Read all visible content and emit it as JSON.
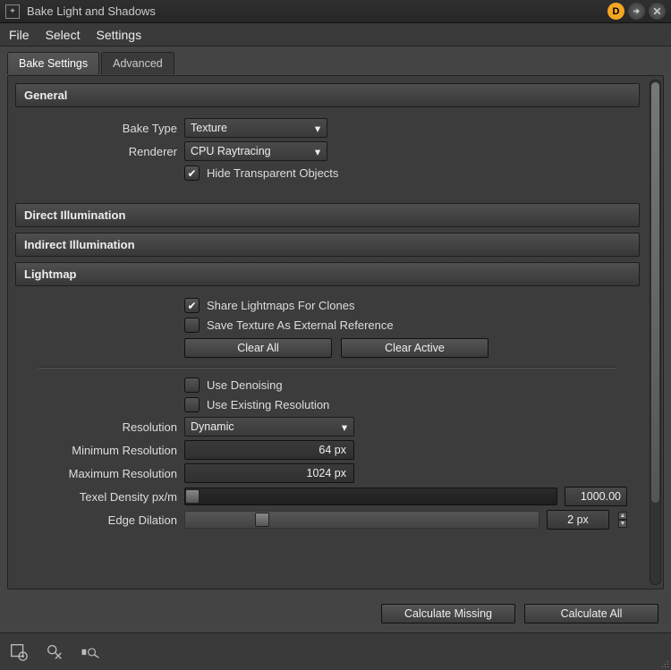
{
  "window": {
    "title": "Bake Light and Shadows",
    "badge": "D"
  },
  "menubar": {
    "file": "File",
    "select": "Select",
    "settings": "Settings"
  },
  "tabs": {
    "bake_settings": "Bake Settings",
    "advanced": "Advanced"
  },
  "sections": {
    "general": {
      "title": "General",
      "bake_type_label": "Bake Type",
      "bake_type_value": "Texture",
      "renderer_label": "Renderer",
      "renderer_value": "CPU Raytracing",
      "hide_transparent_label": "Hide Transparent Objects",
      "hide_transparent_checked": true
    },
    "direct_illum": {
      "title": "Direct Illumination"
    },
    "indirect_illum": {
      "title": "Indirect Illumination"
    },
    "lightmap": {
      "title": "Lightmap",
      "share_clones_label": "Share Lightmaps For Clones",
      "share_clones_checked": true,
      "save_external_label": "Save Texture As External Reference",
      "save_external_checked": false,
      "clear_all": "Clear All",
      "clear_active": "Clear Active",
      "use_denoising_label": "Use Denoising",
      "use_denoising_checked": false,
      "use_existing_label": "Use Existing Resolution",
      "use_existing_checked": false,
      "resolution_label": "Resolution",
      "resolution_value": "Dynamic",
      "min_res_label": "Minimum Resolution",
      "min_res_value": "64 px",
      "max_res_label": "Maximum Resolution",
      "max_res_value": "1024 px",
      "texel_density_label": "Texel Density px/m",
      "texel_density_value": "1000.00",
      "edge_dilation_label": "Edge Dilation",
      "edge_dilation_value": "2 px"
    }
  },
  "actions": {
    "calc_missing": "Calculate Missing",
    "calc_all": "Calculate All"
  }
}
